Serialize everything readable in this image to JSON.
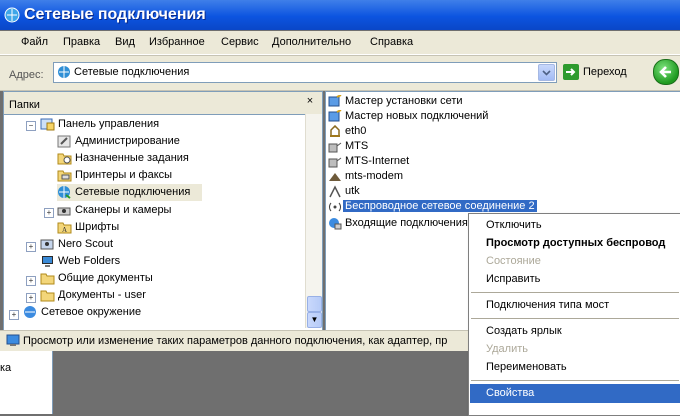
{
  "window": {
    "title": "Сетевые подключения"
  },
  "menu": [
    "Файл",
    "Правка",
    "Вид",
    "Избранное",
    "Сервис",
    "Дополнительно",
    "Справка"
  ],
  "address": {
    "label": "Адрес:",
    "value": "Сетевые подключения",
    "go_label": "Переход"
  },
  "folders": {
    "title": "Папки",
    "close": "×",
    "items": [
      {
        "label": "Панель управления",
        "exp": "−"
      },
      {
        "label": "Администрирование",
        "exp": ""
      },
      {
        "label": "Назначенные задания",
        "exp": ""
      },
      {
        "label": "Принтеры и факсы",
        "exp": ""
      },
      {
        "label": "Сетевые подключения",
        "exp": ""
      },
      {
        "label": "Сканеры и камеры",
        "exp": "+"
      },
      {
        "label": "Шрифты",
        "exp": ""
      },
      {
        "label": "Nero Scout",
        "exp": "+"
      },
      {
        "label": "Web Folders",
        "exp": ""
      },
      {
        "label": "Общие документы",
        "exp": "+"
      },
      {
        "label": "Документы - user",
        "exp": "+"
      },
      {
        "label": "Сетевое окружение",
        "exp": "+"
      }
    ]
  },
  "connections": [
    "Мастер установки сети",
    "Мастер новых подключений",
    "eth0",
    "MTS",
    "MTS-Internet",
    "mts-modem",
    "utk",
    "Беспроводное сетевое соединение 2",
    "Входящие подключения"
  ],
  "status": "Просмотр или изменение таких параметров данного подключения, как адаптер, пр",
  "lower_left_text": "ка",
  "context_menu": [
    {
      "label": "Отключить",
      "state": "normal"
    },
    {
      "label": "Просмотр доступных беспровод",
      "state": "bold"
    },
    {
      "label": "Состояние",
      "state": "disabled"
    },
    {
      "label": "Исправить",
      "state": "normal"
    },
    {
      "label": "Подключения типа мост",
      "state": "normal"
    },
    {
      "label": "Создать ярлык",
      "state": "normal"
    },
    {
      "label": "Удалить",
      "state": "disabled"
    },
    {
      "label": "Переименовать",
      "state": "normal"
    },
    {
      "label": "Свойства",
      "state": "highlighted"
    }
  ],
  "colors": {
    "titlebar": "#0c54e0",
    "selection": "#316ac5",
    "chrome": "#ece9d8"
  }
}
